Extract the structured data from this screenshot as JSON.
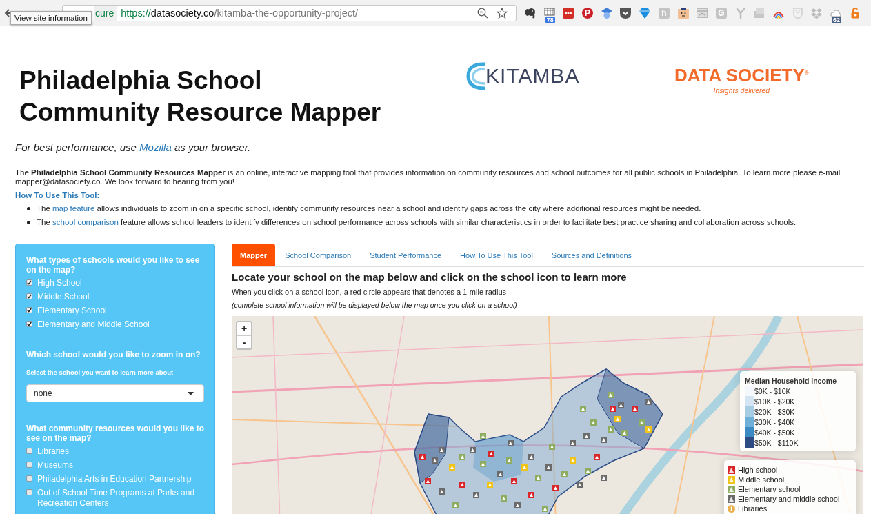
{
  "browser": {
    "tooltip": "View site information",
    "security_label": "cure",
    "url": {
      "scheme": "https://",
      "host": "datasociety.co",
      "path": "/kitamba-the-opportunity-project/"
    },
    "extensions": [
      {
        "kind": "elephant"
      },
      {
        "kind": "grid",
        "badge": "78"
      },
      {
        "kind": "dots"
      },
      {
        "kind": "letter-circle",
        "glyph": "P"
      },
      {
        "kind": "cap"
      },
      {
        "kind": "chevron"
      },
      {
        "kind": "diamond"
      },
      {
        "kind": "letter-tile",
        "glyph": "h"
      },
      {
        "kind": "face"
      },
      {
        "kind": "window"
      },
      {
        "kind": "letter-tile",
        "glyph": "G"
      },
      {
        "kind": "tree"
      },
      {
        "kind": "cards"
      },
      {
        "kind": "arc"
      },
      {
        "kind": "shield"
      },
      {
        "kind": "boxes"
      },
      {
        "kind": "cloud",
        "badge": "62"
      },
      {
        "kind": "lock"
      }
    ]
  },
  "header": {
    "title_lines": [
      "Philadelphia School",
      "Community Resource Mapper"
    ],
    "logos": [
      {
        "kind": "swirl",
        "text": "KITAMBA"
      },
      {
        "kind": "wordmark",
        "text": "DATA SOCIETY$^{®}$",
        "tagline": "Insights delivered"
      }
    ]
  },
  "notice": {
    "before": "For best performance, use ",
    "link": "Mozilla",
    "after": " as your browser."
  },
  "intro": "The **Philadelphia School Community Resources Mapper** is an online, interactive mapping tool that provides information on community resources and school outcomes for all public schools in Philadelphia. To learn more please e-mail mapper@datasociety.co. We look forward to hearing from you!",
  "how_to": {
    "heading": "How To Use This Tool:",
    "bullets": [
      {
        "before": "The ",
        "link": "map feature",
        "after": " allows individuals to zoom in on a specific school, identify community resources near a school and identify gaps across the city where additional resources might be needed."
      },
      {
        "before": "The ",
        "link": "school comparison",
        "after": " feature allows school leaders to identify differences on school performance across schools with similar characteristics in order to facilitate best practice sharing and collaboration across schools."
      }
    ]
  },
  "sidebar": {
    "sections": [
      {
        "kind": "checklist",
        "heading": "What types of schools would you like to see on the map?",
        "items": [
          {
            "label": "High School",
            "checked": true
          },
          {
            "label": "Middle School",
            "checked": true
          },
          {
            "label": "Elementary School",
            "checked": true
          },
          {
            "label": "Elementary and Middle School",
            "checked": true
          }
        ]
      },
      {
        "kind": "select",
        "heading": "Which school would you like to zoom in on?",
        "label": "Select the school you want to learn more about",
        "value": "none"
      },
      {
        "kind": "checklist",
        "heading": "What community resources would you like to see on the map?",
        "items": [
          {
            "label": "Libraries",
            "checked": false
          },
          {
            "label": "Museums",
            "checked": false
          },
          {
            "label": "Philadelphia Arts in Education Partnership",
            "checked": false
          },
          {
            "label": "Out of School Time Programs at Parks and Recreation Centers",
            "checked": false
          }
        ]
      }
    ]
  },
  "tabs": [
    {
      "label": "Mapper",
      "selected": true
    },
    {
      "label": "School Comparison",
      "selected": false
    },
    {
      "label": "Student Performance",
      "selected": false
    },
    {
      "label": "How To Use This Tool",
      "selected": false
    },
    {
      "label": "Sources and Definitions",
      "selected": false
    }
  ],
  "mapper": {
    "heading": "Locate your school on the map below and click on the school icon to learn more",
    "note": "When you click on a school icon, a red circle appears that denotes a 1-mile radius",
    "hint": "(complete school information will be displayed below the map once you click on a school)",
    "map": {
      "zoom_buttons": [
        "+",
        "-"
      ],
      "income_legend": {
        "title": "Median Household Income",
        "items": [
          {
            "label": "$0K - $10K",
            "color": "#f4f8fc"
          },
          {
            "label": "$10K - $20K",
            "color": "#d4e4f2"
          },
          {
            "label": "$20K - $30K",
            "color": "#a6cde4"
          },
          {
            "label": "$30K - $40K",
            "color": "#6eb0d8"
          },
          {
            "label": "$40K - $50K",
            "color": "#3b8ac4"
          },
          {
            "label": "$50K - $110K",
            "color": "#2b4b82"
          }
        ]
      },
      "school_legend": {
        "items": [
          {
            "kind": "school",
            "label": "High school",
            "color": "#d9262b"
          },
          {
            "kind": "school",
            "label": "Middle school",
            "color": "#f0c419"
          },
          {
            "kind": "school",
            "label": "Elementary school",
            "color": "#8fad61"
          },
          {
            "kind": "school",
            "label": "Elementary and middle school",
            "color": "#6b6b6b"
          },
          {
            "kind": "library",
            "label": "Libraries",
            "color": "#eab04c"
          }
        ]
      }
    }
  }
}
